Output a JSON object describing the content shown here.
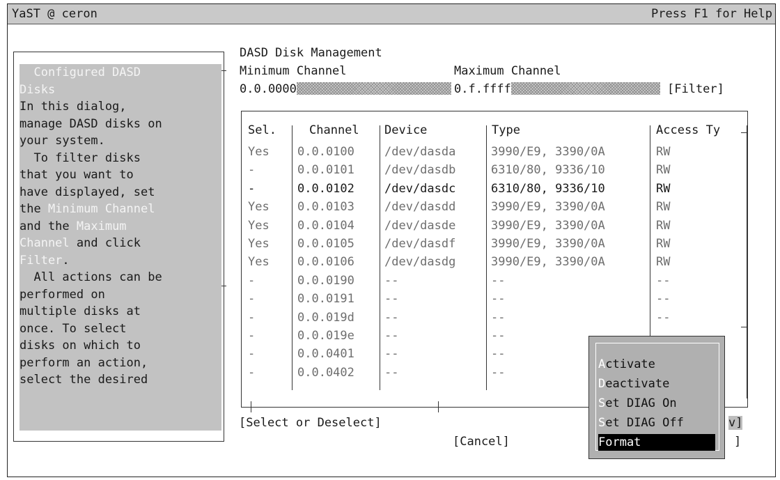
{
  "window": {
    "title": "YaST @ ceron",
    "help_hint": "Press F1 for Help"
  },
  "help": {
    "box_title": "Configured DASD Disks",
    "lines": [
      [
        {
          "t": "  Configured DASD",
          "dim": true
        }
      ],
      [
        {
          "t": "Disks",
          "dim": true
        }
      ],
      [
        {
          "t": "In this dialog,"
        }
      ],
      [
        {
          "t": "manage DASD disks on"
        }
      ],
      [
        {
          "t": "your system."
        }
      ],
      [
        {
          "t": "  To filter disks"
        }
      ],
      [
        {
          "t": "that you want to"
        }
      ],
      [
        {
          "t": "have displayed, set"
        }
      ],
      [
        {
          "t": "the "
        },
        {
          "t": "Minimum Channel",
          "dim": true
        }
      ],
      [
        {
          "t": "and the "
        },
        {
          "t": "Maximum",
          "dim": true
        }
      ],
      [
        {
          "t": "Channel",
          "dim": true
        },
        {
          "t": " and click"
        }
      ],
      [
        {
          "t": "Filter",
          "dim": true
        },
        {
          "t": "."
        }
      ],
      [
        {
          "t": "  All actions can be"
        }
      ],
      [
        {
          "t": "performed on"
        }
      ],
      [
        {
          "t": "multiple disks at"
        }
      ],
      [
        {
          "t": "once. To select"
        }
      ],
      [
        {
          "t": "disks on which to"
        }
      ],
      [
        {
          "t": "perform an action,"
        }
      ],
      [
        {
          "t": "select the desired"
        }
      ]
    ]
  },
  "dialog": {
    "title": "DASD Disk Management",
    "min_channel_label": "Minimum Channel",
    "max_channel_label": "Maximum Channel",
    "min_channel_value": "0.0.0000",
    "max_channel_value": "0.f.ffff",
    "filter_button": "[Filter]",
    "select_button": "[Select or Deselect]",
    "cancel_button": "[Cancel]"
  },
  "table": {
    "columns": [
      "Sel.",
      "Channel",
      "Device",
      "Type",
      "Access Ty"
    ],
    "rows": [
      {
        "sel": "Yes",
        "channel": "0.0.0100",
        "device": "/dev/dasda",
        "type": "3990/E9, 3390/0A",
        "access": "RW"
      },
      {
        "sel": "-",
        "channel": "0.0.0101",
        "device": "/dev/dasdb",
        "type": "6310/80, 9336/10",
        "access": "RW"
      },
      {
        "sel": "-",
        "channel": "0.0.0102",
        "device": "/dev/dasdc",
        "type": "6310/80, 9336/10",
        "access": "RW"
      },
      {
        "sel": "Yes",
        "channel": "0.0.0103",
        "device": "/dev/dasdd",
        "type": "3990/E9, 3390/0A",
        "access": "RW"
      },
      {
        "sel": "Yes",
        "channel": "0.0.0104",
        "device": "/dev/dasde",
        "type": "3990/E9, 3390/0A",
        "access": "RW"
      },
      {
        "sel": "Yes",
        "channel": "0.0.0105",
        "device": "/dev/dasdf",
        "type": "3990/E9, 3390/0A",
        "access": "RW"
      },
      {
        "sel": "Yes",
        "channel": "0.0.0106",
        "device": "/dev/dasdg",
        "type": "3990/E9, 3390/0A",
        "access": "RW"
      },
      {
        "sel": "-",
        "channel": "0.0.0190",
        "device": "--",
        "type": "--",
        "access": "--"
      },
      {
        "sel": "-",
        "channel": "0.0.0191",
        "device": "--",
        "type": "--",
        "access": "--"
      },
      {
        "sel": "-",
        "channel": "0.0.019d",
        "device": "--",
        "type": "--",
        "access": "--"
      },
      {
        "sel": "-",
        "channel": "0.0.019e",
        "device": "--",
        "type": "--",
        "access": ""
      },
      {
        "sel": "-",
        "channel": "0.0.0401",
        "device": "--",
        "type": "--",
        "access": ""
      },
      {
        "sel": "-",
        "channel": "0.0.0402",
        "device": "--",
        "type": "--",
        "access": ""
      }
    ]
  },
  "popup_menu": {
    "items": [
      "Activate",
      "Deactivate",
      "Set DIAG On",
      "Set DIAG Off",
      "Format"
    ],
    "selected_index": 4
  },
  "edge_fragments": {
    "right_bracket_v": "v]",
    "right_bracket": "]"
  },
  "colors": {
    "title_bar": "#c9c9c9",
    "help_panel": "#c2c2c2",
    "popup": "#b0b0b0",
    "selected_item": "#000000"
  }
}
